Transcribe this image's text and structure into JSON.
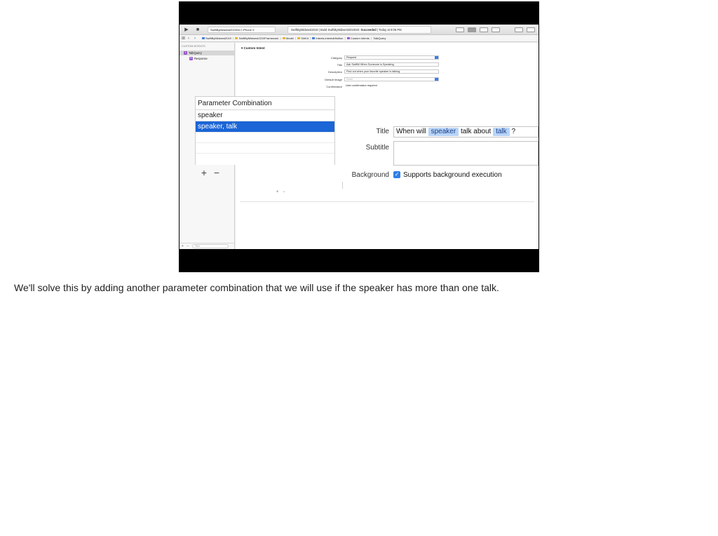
{
  "toolbar": {
    "run_icon": "▶",
    "stop_icon": "■",
    "scheme": "SwiftByMidwest2019Siri ⟩ iPhone X",
    "status_prefix": "SwiftByMidwest2019 | Build SwiftByMidwest2019Siri:",
    "status_result": "Succeeded",
    "status_time": "| Today at 9:08 PM",
    "icons": [
      "code-brackets-icon",
      "editor-standard-icon",
      "editor-assistant-icon",
      "editor-version-icon",
      "navigator-toggle-icon",
      "inspector-toggle-icon"
    ]
  },
  "jumpbar": {
    "grid_icon": "⊞",
    "back": "‹",
    "forward": "›",
    "crumbs": [
      {
        "label": "SwiftByMidwest2019",
        "kind": "blue"
      },
      {
        "label": "SwiftByMidwest2219Framework",
        "kind": "folder"
      },
      {
        "label": "Model",
        "kind": "folder"
      },
      {
        "label": "SiriKit",
        "kind": "folder"
      },
      {
        "label": "Intents.intentdefinition",
        "kind": "blue"
      },
      {
        "label": "Custom Intents",
        "kind": "purple"
      },
      {
        "label": "TalkQuery",
        "kind": "none"
      }
    ]
  },
  "navigator": {
    "heading": "CUSTOM INTENTS",
    "items": [
      {
        "label": "TalkQuery",
        "badge": "I",
        "color": "#9b59d0"
      },
      {
        "label": "Response",
        "badge": "R",
        "color": "#9b59d0"
      }
    ],
    "footer_add": "+",
    "footer_remove": "−",
    "filter_placeholder": "Filter"
  },
  "editor": {
    "section": "Custom Intent",
    "category_label": "Category",
    "category_value": "Request",
    "title_label": "Title",
    "title_value": "Ask SwiftM When Someone is Speaking",
    "description_label": "Description",
    "description_value": "Find out when your favorite speaker is talking",
    "image_label": "Default Image",
    "image_value": "None",
    "confirmation_label": "Confirmation",
    "confirmation_value": "User confirmation required",
    "small_add": "+",
    "small_remove": "−"
  },
  "zoom": {
    "table_header": "Parameter Combination",
    "rows": [
      "speaker",
      "speaker, talk"
    ],
    "add": "+",
    "remove": "−",
    "title_label": "Title",
    "title_parts": {
      "p1": "When will",
      "t1": "speaker",
      "p2": "talk about",
      "t2": "talk",
      "p3": "?"
    },
    "subtitle_label": "Subtitle",
    "background_label": "Background",
    "background_option": "Supports background execution",
    "checkmark": "✓"
  },
  "caption": "We'll solve this by adding another parameter combination that we will use if the speaker has more than one talk."
}
